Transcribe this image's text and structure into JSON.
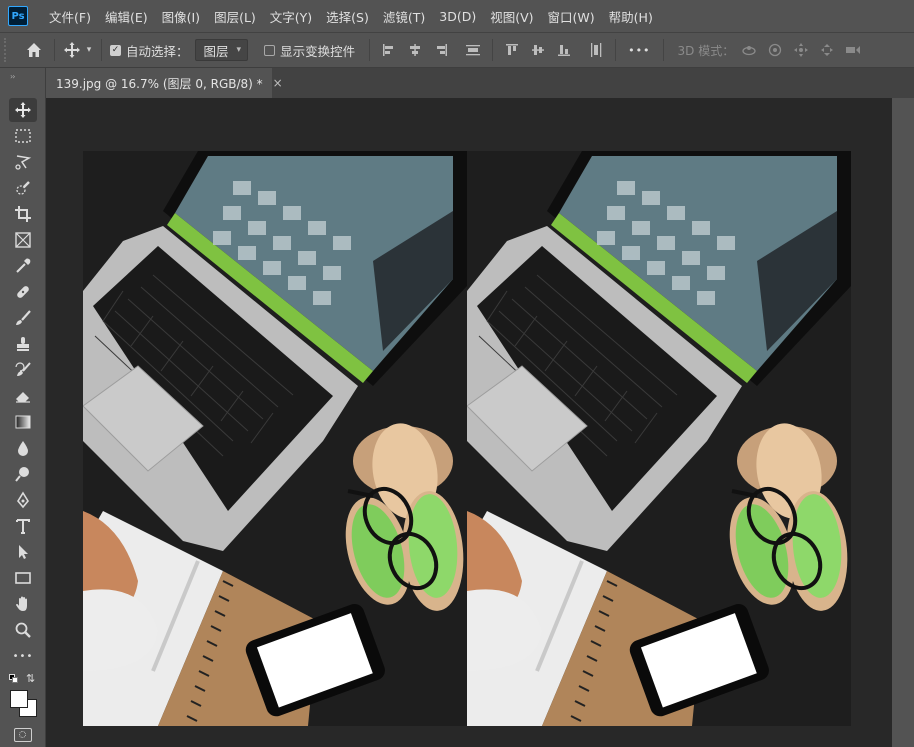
{
  "app": {
    "logo": "Ps"
  },
  "menu": [
    "文件(F)",
    "编辑(E)",
    "图像(I)",
    "图层(L)",
    "文字(Y)",
    "选择(S)",
    "滤镜(T)",
    "3D(D)",
    "视图(V)",
    "窗口(W)",
    "帮助(H)"
  ],
  "options": {
    "auto_select_label": "自动选择：",
    "auto_select_checked": true,
    "layer_dropdown": "图层",
    "show_transform_label": "显示变换控件",
    "show_transform_checked": false,
    "more": "•••",
    "mode_label": "3D 模式："
  },
  "document": {
    "tab_title": "139.jpg @ 16.7% (图层 0, RGB/8) *",
    "close": "×"
  },
  "colors": {
    "ui_bg": "#535353",
    "canvas_bg": "#282828",
    "accent": "#31a8ff"
  },
  "tools": [
    "move-tool",
    "marquee-tool",
    "lasso-tool",
    "quick-select-tool",
    "crop-tool",
    "frame-tool",
    "eyedropper-tool",
    "healing-tool",
    "brush-tool",
    "stamp-tool",
    "history-brush-tool",
    "eraser-tool",
    "gradient-tool",
    "blur-tool",
    "dodge-tool",
    "pen-tool",
    "type-tool",
    "path-select-tool",
    "rectangle-tool",
    "hand-tool",
    "zoom-tool",
    "more-tools"
  ]
}
